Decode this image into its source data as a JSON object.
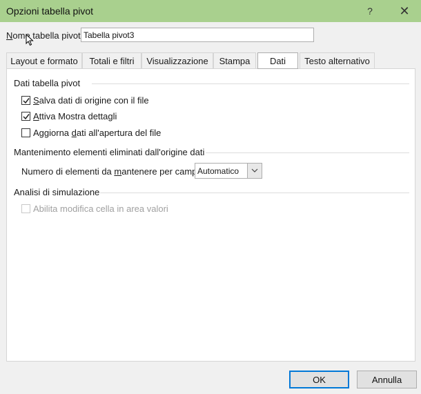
{
  "window": {
    "title": "Opzioni tabella pivot",
    "help_glyph": "?",
    "close_glyph": "✕",
    "titlebar_color": "#a9d08e"
  },
  "name_field": {
    "label_mnemonic": "N",
    "label_rest": "ome tabella pivot:",
    "value": "Tabella pivot3"
  },
  "tabs": [
    {
      "label": "Layout e formato"
    },
    {
      "label": "Totali e filtri"
    },
    {
      "label": "Visualizzazione"
    },
    {
      "label": "Stampa"
    },
    {
      "label": "Dati",
      "active": true
    },
    {
      "label": "Testo alternativo"
    }
  ],
  "dati_tabella_pivot": {
    "title": "Dati tabella pivot",
    "options": [
      {
        "pre": "",
        "mnemonic": "S",
        "post": "alva dati di origine con il file",
        "checked": true
      },
      {
        "pre": "",
        "mnemonic": "A",
        "post": "ttiva Mostra dettagli",
        "checked": true
      },
      {
        "pre": "Aggiorna ",
        "mnemonic": "d",
        "post": "ati all'apertura del file",
        "checked": false
      }
    ]
  },
  "mantenimento": {
    "title": "Mantenimento elementi eliminati dall'origine dati",
    "label_pre": "Numero di elementi da ",
    "label_mnemonic": "m",
    "label_post": "antenere per campo:",
    "select_value": "Automatico"
  },
  "analisi": {
    "title": "Analisi di simulazione",
    "option": {
      "label": "Abilita modifica cella in area valori",
      "checked": false,
      "disabled": true
    }
  },
  "footer": {
    "ok_label": "OK",
    "cancel_label": "Annulla"
  },
  "colors": {
    "accent": "#0078d7"
  }
}
